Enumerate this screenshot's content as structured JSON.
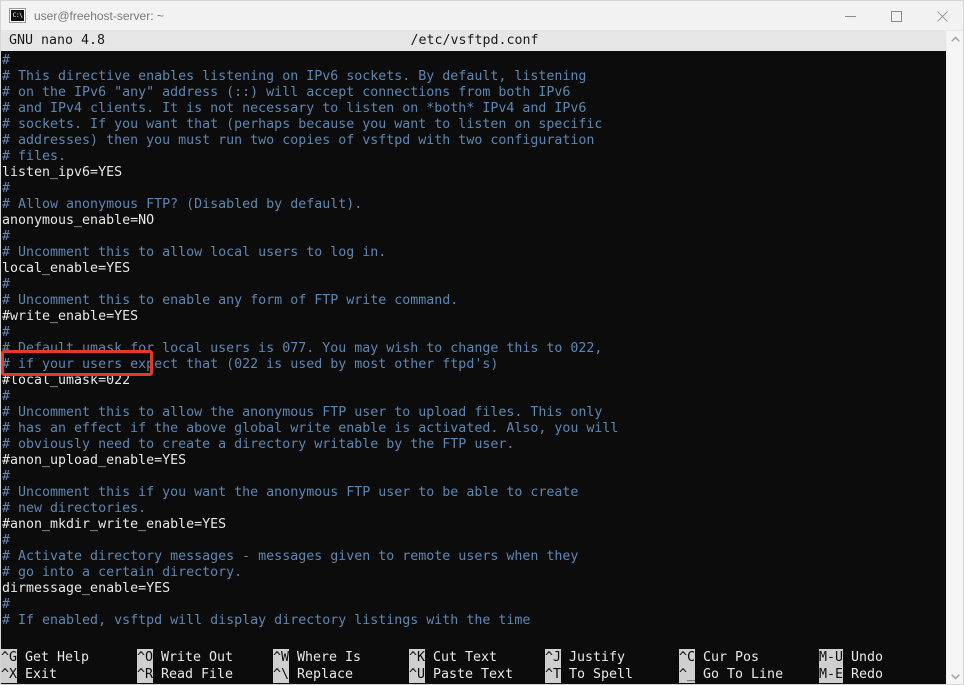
{
  "window": {
    "title": "user@freehost-server: ~",
    "icon": "console-icon",
    "controls": {
      "minimize": "minimize-icon",
      "maximize": "maximize-icon",
      "close": "close-icon"
    }
  },
  "nano": {
    "version_label": "GNU nano 4.8",
    "filename": "/etc/vsftpd.conf"
  },
  "annotation": {
    "color": "#e23b2e",
    "target_line": "#write_enable=YES"
  },
  "colors": {
    "comment": "#5c87b2",
    "config": "#e8e8e8",
    "background": "#0c0c0c",
    "header_bg": "#e6e6e6",
    "key_bg": "#cfcfcf"
  },
  "editor": {
    "lines": [
      {
        "text": "#",
        "type": "comment"
      },
      {
        "text": "# This directive enables listening on IPv6 sockets. By default, listening",
        "type": "comment"
      },
      {
        "text": "# on the IPv6 \"any\" address (::) will accept connections from both IPv6",
        "type": "comment"
      },
      {
        "text": "# and IPv4 clients. It is not necessary to listen on *both* IPv4 and IPv6",
        "type": "comment"
      },
      {
        "text": "# sockets. If you want that (perhaps because you want to listen on specific",
        "type": "comment"
      },
      {
        "text": "# addresses) then you must run two copies of vsftpd with two configuration",
        "type": "comment"
      },
      {
        "text": "# files.",
        "type": "comment"
      },
      {
        "text": "listen_ipv6=YES",
        "type": "config"
      },
      {
        "text": "#",
        "type": "comment"
      },
      {
        "text": "# Allow anonymous FTP? (Disabled by default).",
        "type": "comment"
      },
      {
        "text": "anonymous_enable=NO",
        "type": "config"
      },
      {
        "text": "#",
        "type": "comment"
      },
      {
        "text": "# Uncomment this to allow local users to log in.",
        "type": "comment"
      },
      {
        "text": "local_enable=YES",
        "type": "config"
      },
      {
        "text": "#",
        "type": "comment"
      },
      {
        "text": "# Uncomment this to enable any form of FTP write command.",
        "type": "comment"
      },
      {
        "text": "#write_enable=YES",
        "type": "config"
      },
      {
        "text": "#",
        "type": "comment"
      },
      {
        "text": "# Default umask for local users is 077. You may wish to change this to 022,",
        "type": "comment"
      },
      {
        "text": "# if your users expect that (022 is used by most other ftpd's)",
        "type": "comment"
      },
      {
        "text": "#local_umask=022",
        "type": "config"
      },
      {
        "text": "#",
        "type": "comment"
      },
      {
        "text": "# Uncomment this to allow the anonymous FTP user to upload files. This only",
        "type": "comment"
      },
      {
        "text": "# has an effect if the above global write enable is activated. Also, you will",
        "type": "comment"
      },
      {
        "text": "# obviously need to create a directory writable by the FTP user.",
        "type": "comment"
      },
      {
        "text": "#anon_upload_enable=YES",
        "type": "config"
      },
      {
        "text": "#",
        "type": "comment"
      },
      {
        "text": "# Uncomment this if you want the anonymous FTP user to be able to create",
        "type": "comment"
      },
      {
        "text": "# new directories.",
        "type": "comment"
      },
      {
        "text": "#anon_mkdir_write_enable=YES",
        "type": "config"
      },
      {
        "text": "#",
        "type": "comment"
      },
      {
        "text": "# Activate directory messages - messages given to remote users when they",
        "type": "comment"
      },
      {
        "text": "# go into a certain directory.",
        "type": "comment"
      },
      {
        "text": "dirmessage_enable=YES",
        "type": "config"
      },
      {
        "text": "#",
        "type": "comment"
      },
      {
        "text": "# If enabled, vsftpd will display directory listings with the time",
        "type": "comment"
      }
    ]
  },
  "shortcuts": [
    {
      "top_key": "^G",
      "top_label": "Get Help",
      "bottom_key": "^X",
      "bottom_label": "Exit"
    },
    {
      "top_key": "^O",
      "top_label": "Write Out",
      "bottom_key": "^R",
      "bottom_label": "Read File"
    },
    {
      "top_key": "^W",
      "top_label": "Where Is",
      "bottom_key": "^\\",
      "bottom_label": "Replace"
    },
    {
      "top_key": "^K",
      "top_label": "Cut Text",
      "bottom_key": "^U",
      "bottom_label": "Paste Text"
    },
    {
      "top_key": "^J",
      "top_label": "Justify",
      "bottom_key": "^T",
      "bottom_label": "To Spell"
    },
    {
      "top_key": "^C",
      "top_label": "Cur Pos",
      "bottom_key": "^_",
      "bottom_label": "Go To Line"
    },
    {
      "top_key": "M-U",
      "top_label": "Undo",
      "bottom_key": "M-E",
      "bottom_label": "Redo"
    }
  ],
  "scrollbar": {
    "up_arrow": "chevron-up-icon",
    "down_arrow": "chevron-down-icon"
  }
}
